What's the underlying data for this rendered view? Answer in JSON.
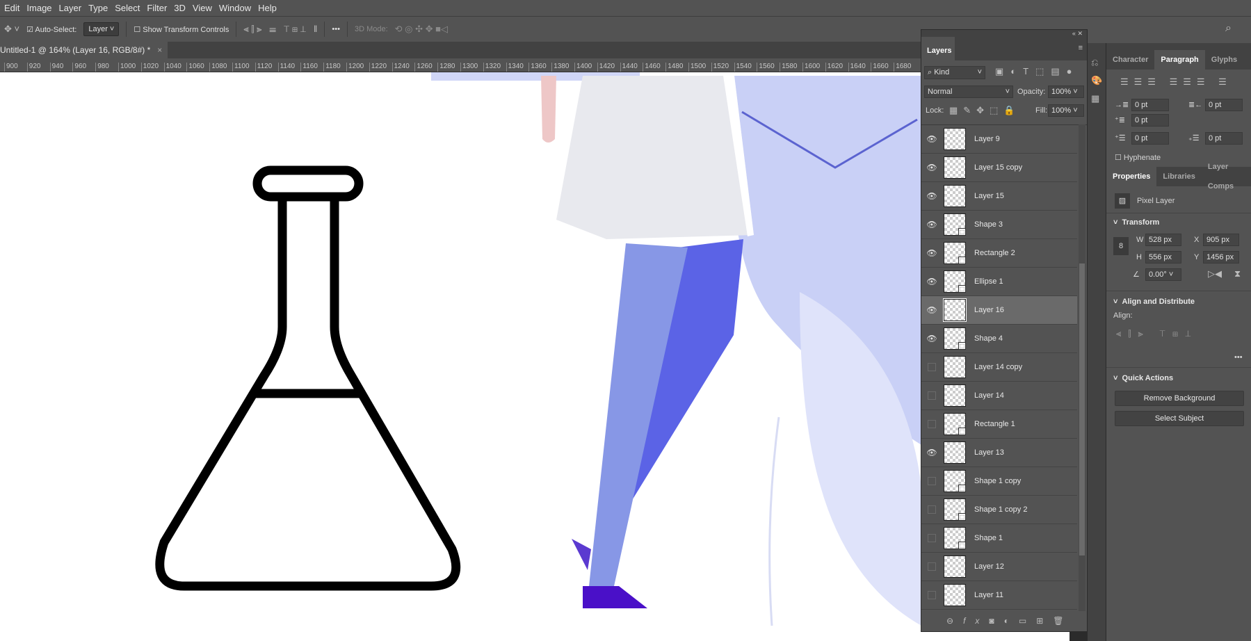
{
  "menu": [
    "Edit",
    "Image",
    "Layer",
    "Type",
    "Select",
    "Filter",
    "3D",
    "View",
    "Window",
    "Help"
  ],
  "options": {
    "auto_select": "Auto-Select:",
    "auto_select_value": "Layer",
    "show_transform": "Show Transform Controls",
    "mode_3d": "3D Mode:",
    "more": "•••"
  },
  "document_tab": {
    "title": "Untitled-1 @ 164% (Layer 16, RGB/8#) *",
    "close": "×"
  },
  "ruler": [
    "900",
    "920",
    "940",
    "960",
    "980",
    "1000",
    "1020",
    "1040",
    "1060",
    "1080",
    "1100",
    "1120",
    "1140",
    "1160",
    "1180",
    "1200",
    "1220",
    "1240",
    "1260",
    "1280",
    "1300",
    "1320",
    "1340",
    "1360",
    "1380",
    "1400",
    "1420",
    "1440",
    "1460",
    "1480",
    "1500",
    "1520",
    "1540",
    "1560",
    "1580",
    "1600",
    "1620",
    "1640",
    "1660",
    "1680"
  ],
  "layers_panel": {
    "title": "Layers",
    "filter": "Kind",
    "blend": "Normal",
    "opacity_label": "Opacity:",
    "opacity": "100%",
    "lock_label": "Lock:",
    "fill_label": "Fill:",
    "fill": "100%",
    "layers": [
      {
        "name": "Layer 9",
        "visible": true,
        "shape": false
      },
      {
        "name": "Layer 15 copy",
        "visible": true,
        "shape": false
      },
      {
        "name": "Layer 15",
        "visible": true,
        "shape": false
      },
      {
        "name": "Shape 3",
        "visible": true,
        "shape": true
      },
      {
        "name": "Rectangle 2",
        "visible": true,
        "shape": true
      },
      {
        "name": "Ellipse 1",
        "visible": true,
        "shape": true
      },
      {
        "name": "Layer 16",
        "visible": true,
        "shape": false,
        "selected": true
      },
      {
        "name": "Shape 4",
        "visible": true,
        "shape": true
      },
      {
        "name": "Layer 14 copy",
        "visible": false,
        "shape": false
      },
      {
        "name": "Layer 14",
        "visible": false,
        "shape": false
      },
      {
        "name": "Rectangle 1",
        "visible": false,
        "shape": true
      },
      {
        "name": "Layer 13",
        "visible": true,
        "shape": false
      },
      {
        "name": "Shape 1 copy",
        "visible": false,
        "shape": true
      },
      {
        "name": "Shape 1 copy 2",
        "visible": false,
        "shape": true
      },
      {
        "name": "Shape 1",
        "visible": false,
        "shape": true
      },
      {
        "name": "Layer 12",
        "visible": false,
        "shape": false
      },
      {
        "name": "Layer 11",
        "visible": false,
        "shape": false
      }
    ]
  },
  "paragraph": {
    "tabs": [
      "Character",
      "Paragraph",
      "Glyphs"
    ],
    "indent_left": "0 pt",
    "indent_right": "0 pt",
    "indent_first": "0 pt",
    "space_before": "0 pt",
    "space_after": "0 pt",
    "hyphenate": "Hyphenate"
  },
  "properties": {
    "tabs": [
      "Properties",
      "Libraries",
      "Layer Comps"
    ],
    "type": "Pixel Layer",
    "transform": "Transform",
    "w_label": "W",
    "w": "528 px",
    "h_label": "H",
    "h": "556 px",
    "x_label": "X",
    "x": "905 px",
    "y_label": "Y",
    "y": "1456 px",
    "angle": "0.00°",
    "align_title": "Align and Distribute",
    "align_label": "Align:",
    "quick_title": "Quick Actions",
    "remove_bg": "Remove Background",
    "select_subject": "Select Subject",
    "more": "•••"
  },
  "colors": {
    "accent_leg_light": "#8797e6",
    "accent_leg_dark": "#5b63e6",
    "shoe": "#4a10c8",
    "bg_blue": "#c6cdf5"
  }
}
